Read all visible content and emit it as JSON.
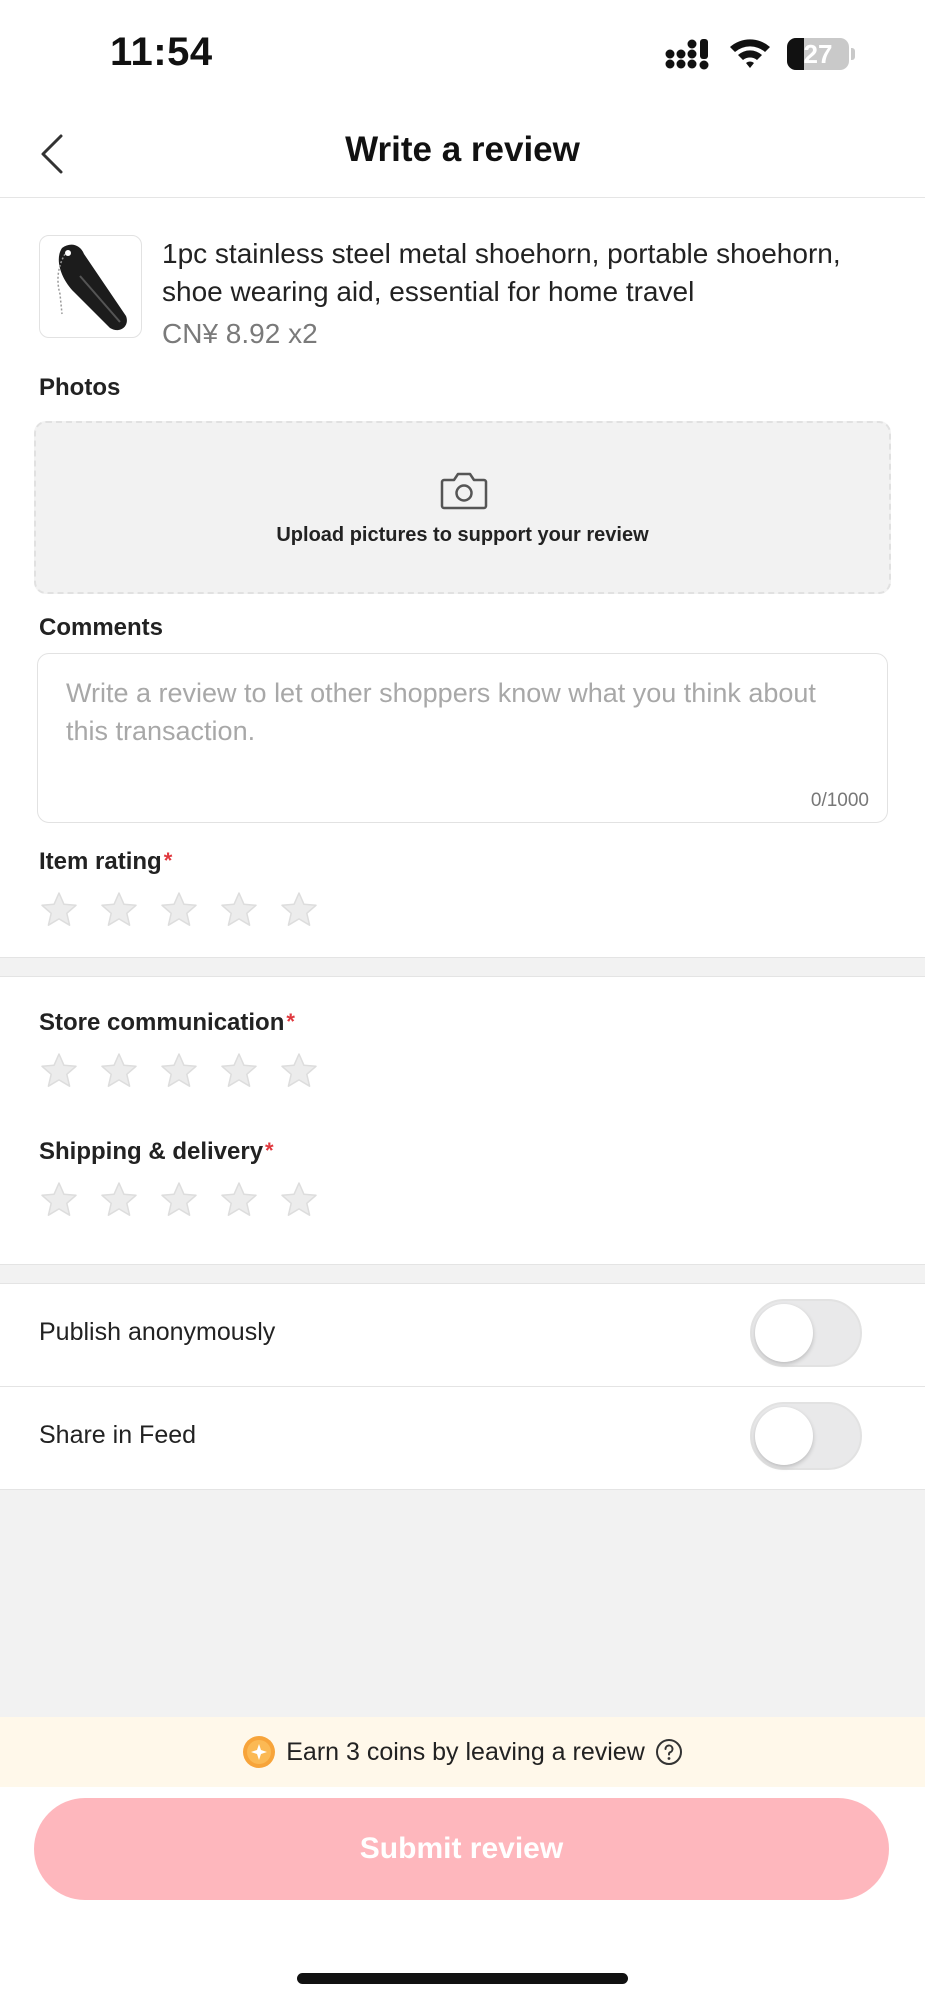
{
  "status_bar": {
    "time": "11:54",
    "battery_level": "27",
    "battery_fraction": 0.27
  },
  "header": {
    "title": "Write a review",
    "back_icon": "chevron-left-icon"
  },
  "product": {
    "title": "1pc stainless steel metal shoehorn, portable shoehorn, shoe wearing aid, essential for home travel",
    "price": "CN¥ 8.92 x2"
  },
  "photos": {
    "label": "Photos",
    "upload_text": "Upload pictures to support your review",
    "icon": "camera-icon"
  },
  "comments": {
    "label": "Comments",
    "placeholder": "Write a review to let other shoppers know what you think about this transaction.",
    "value": "",
    "char_count": "0/1000"
  },
  "ratings": [
    {
      "label": "Item rating",
      "required_mark": "*",
      "stars": 5,
      "selected": 0
    },
    {
      "label": "Store communication",
      "required_mark": "*",
      "stars": 5,
      "selected": 0
    },
    {
      "label": "Shipping & delivery",
      "required_mark": "*",
      "stars": 5,
      "selected": 0
    }
  ],
  "toggles": [
    {
      "label": "Publish anonymously",
      "on": false
    },
    {
      "label": "Share in Feed",
      "on": false
    }
  ],
  "coins_banner": {
    "text": "Earn 3 coins by leaving a review",
    "icon": "coin-icon",
    "help_icon": "help-circle-icon"
  },
  "submit": {
    "label": "Submit review"
  },
  "colors": {
    "accent_disabled": "#feb7bd",
    "required": "#e0383e",
    "banner_bg": "#fff8ea",
    "coin": "#f7a43a"
  }
}
